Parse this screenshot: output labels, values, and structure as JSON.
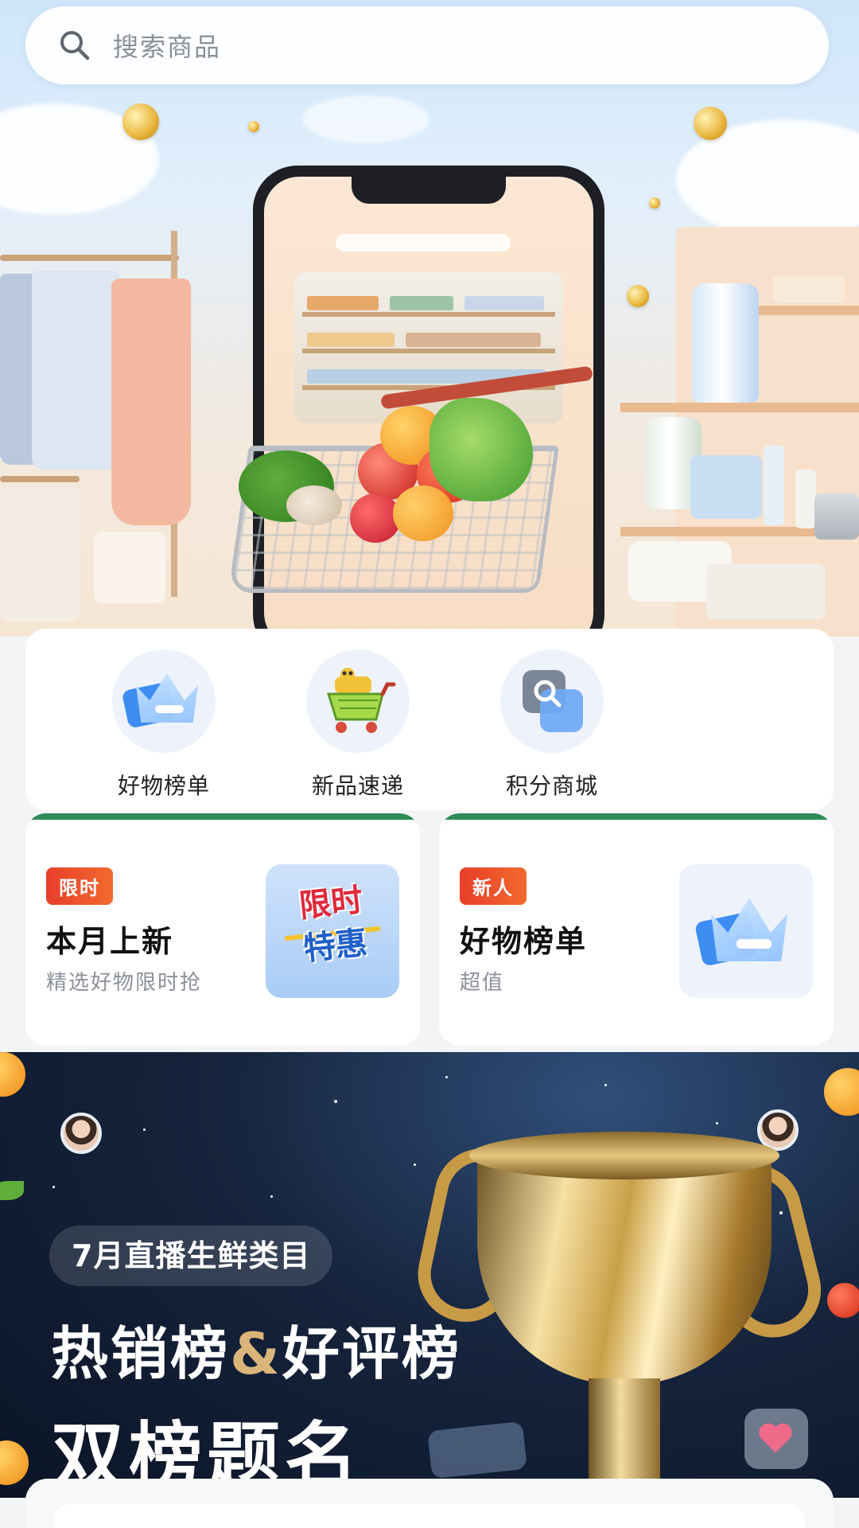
{
  "search": {
    "placeholder": "搜索商品"
  },
  "quick_menu": {
    "items": [
      {
        "label": "好物榜单",
        "icon": "crown-icon"
      },
      {
        "label": "新品速递",
        "icon": "shopping-cart-icon"
      },
      {
        "label": "积分商城",
        "icon": "search-square-icon"
      }
    ]
  },
  "promos": [
    {
      "badge": "限时",
      "title": "本月上新",
      "subtitle": "精选好物限时抢",
      "image_text_line1": "限时",
      "image_text_line2": "特惠"
    },
    {
      "badge": "新人",
      "title": "好物榜单",
      "subtitle": "超值",
      "icon": "crown-icon"
    }
  ],
  "banner": {
    "pill": "7月直播生鲜类目",
    "title_part1": "热销榜",
    "title_amp": "&",
    "title_part2": "好评榜",
    "title_line2": "双榜题名"
  },
  "colors": {
    "accent_green": "#2e8b57",
    "badge_red": "#e83e2a",
    "icon_blue": "#3d8df3",
    "banner_bg": "#16243d"
  }
}
